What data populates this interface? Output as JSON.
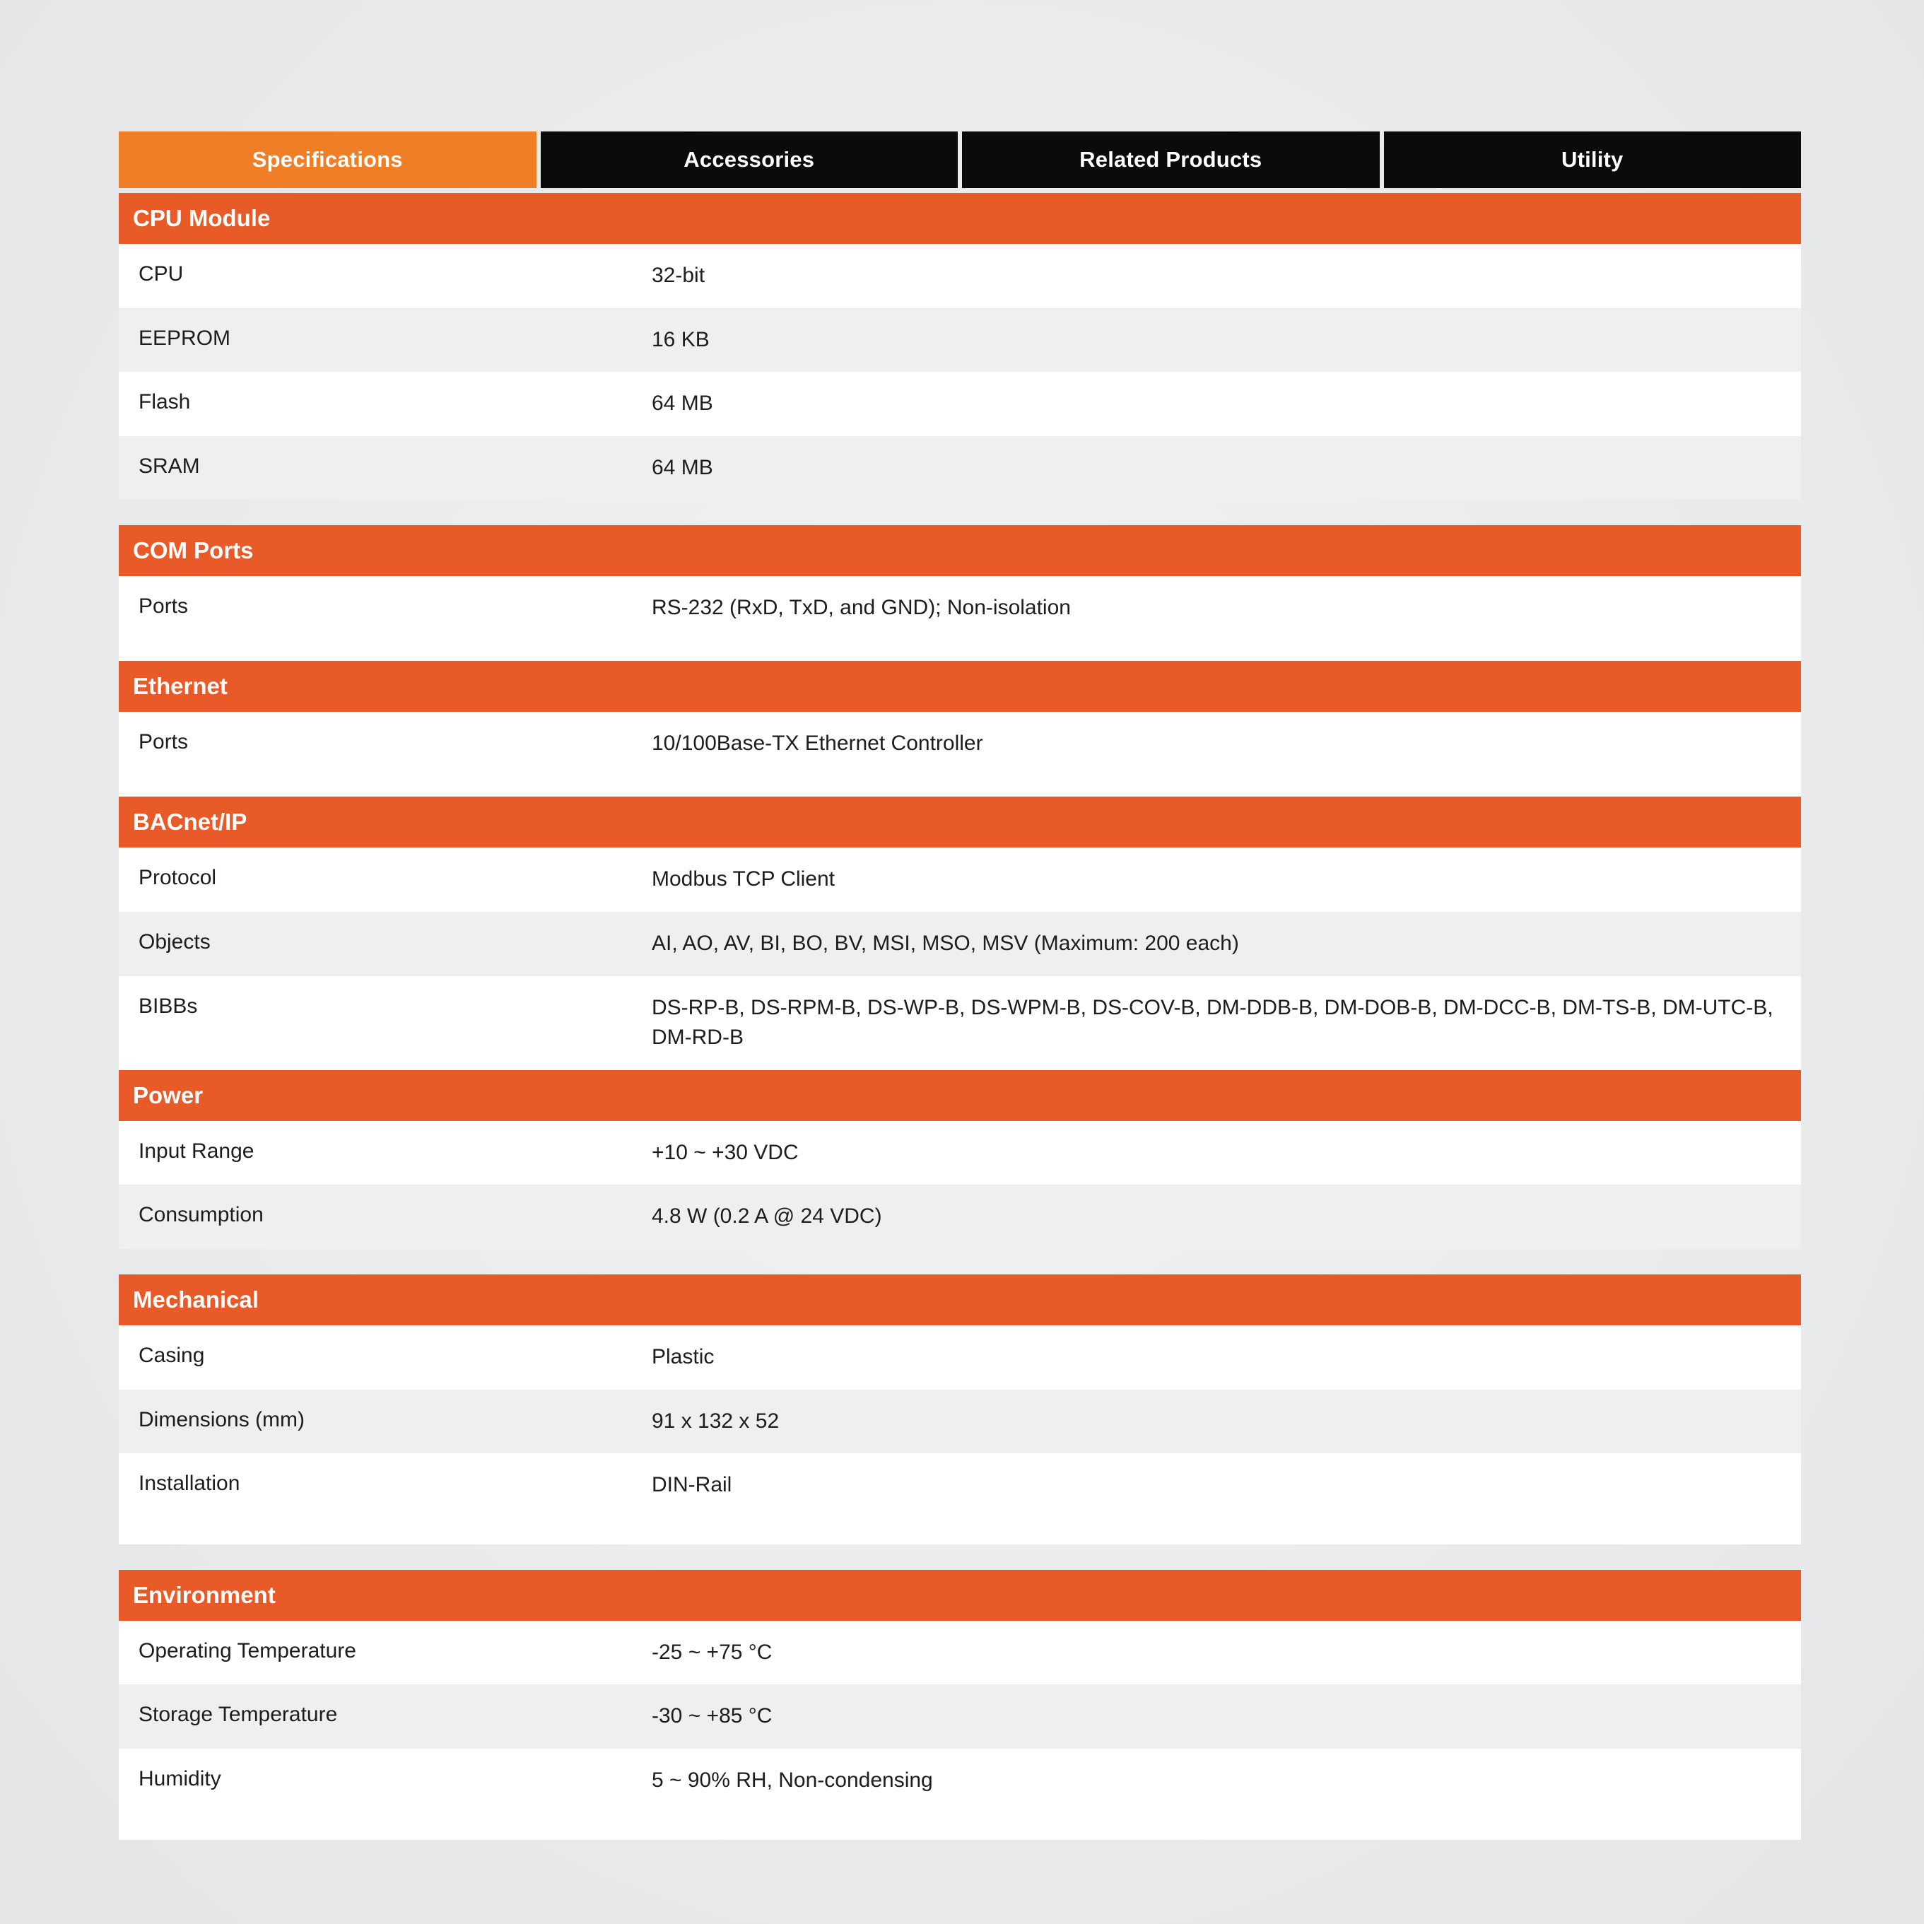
{
  "colors": {
    "tab_active_bg": "#EF7E26",
    "tab_inactive_bg": "#0B0B0C",
    "section_header_bg": "#E85A28",
    "row_bg": "#FFFFFF",
    "row_alt_bg": "#EEEFF0",
    "page_bg": "#EBECEE",
    "text": "#1D1D1F"
  },
  "tabs": [
    {
      "label": "Specifications",
      "active": true
    },
    {
      "label": "Accessories",
      "active": false
    },
    {
      "label": "Related Products",
      "active": false
    },
    {
      "label": "Utility",
      "active": false
    }
  ],
  "sections": [
    {
      "title": "CPU Module",
      "rows": [
        {
          "label": "CPU",
          "value": "32-bit"
        },
        {
          "label": "EEPROM",
          "value": "16 KB"
        },
        {
          "label": "Flash",
          "value": "64 MB"
        },
        {
          "label": "SRAM",
          "value": "64 MB"
        }
      ]
    },
    {
      "title": "COM Ports",
      "rows": [
        {
          "label": "Ports",
          "value": "RS-232 (RxD, TxD, and GND); Non-isolation"
        }
      ]
    },
    {
      "title": "Ethernet",
      "rows": [
        {
          "label": "Ports",
          "value": "10/100Base-TX Ethernet Controller"
        }
      ]
    },
    {
      "title": "BACnet/IP",
      "rows": [
        {
          "label": "Protocol",
          "value": "Modbus TCP Client"
        },
        {
          "label": "Objects",
          "value": "AI, AO, AV, BI, BO, BV, MSI, MSO, MSV (Maximum: 200 each)"
        },
        {
          "label": "BIBBs",
          "value": "DS-RP-B, DS-RPM-B, DS-WP-B, DS-WPM-B, DS-COV-B, DM-DDB-B, DM-DOB-B, DM-DCC-B, DM-TS-B, DM-UTC-B, DM-RD-B"
        }
      ]
    },
    {
      "title": "Power",
      "rows": [
        {
          "label": "Input Range",
          "value": "+10 ~ +30 VDC"
        },
        {
          "label": "Consumption",
          "value": "4.8 W (0.2 A @ 24 VDC)"
        }
      ]
    },
    {
      "title": "Mechanical",
      "rows": [
        {
          "label": "Casing",
          "value": "Plastic"
        },
        {
          "label": "Dimensions (mm)",
          "value": "91 x 132 x 52"
        },
        {
          "label": "Installation",
          "value": "DIN-Rail"
        }
      ]
    },
    {
      "title": "Environment",
      "rows": [
        {
          "label": "Operating Temperature",
          "value": "-25 ~ +75 °C"
        },
        {
          "label": "Storage Temperature",
          "value": "-30 ~ +85 °C"
        },
        {
          "label": "Humidity",
          "value": "5 ~ 90% RH, Non-condensing"
        }
      ]
    }
  ]
}
